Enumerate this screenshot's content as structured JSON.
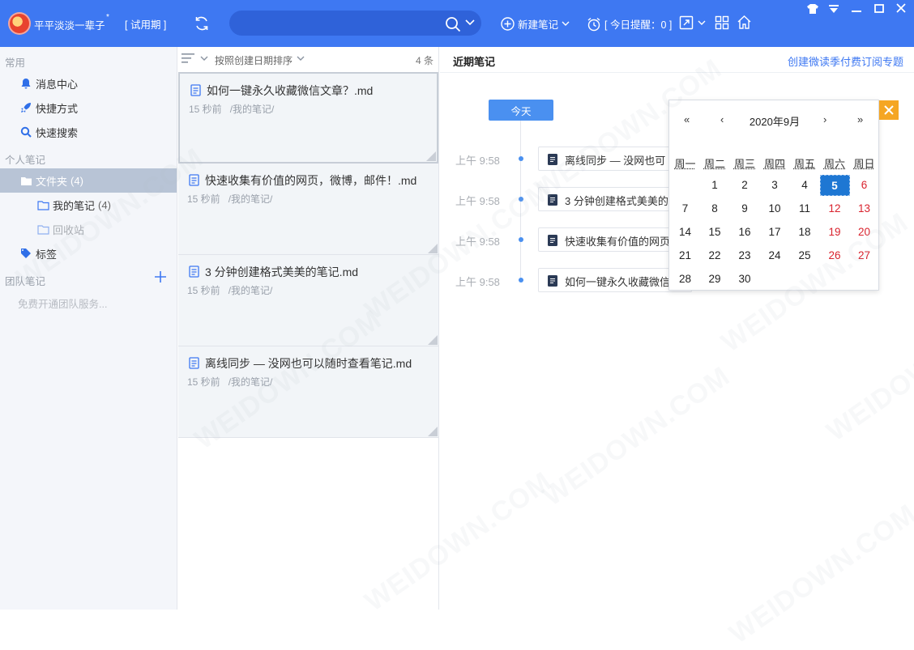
{
  "app": {
    "username": "平平淡淡一辈子",
    "username_mark": "*",
    "trial": "[ 试用期 ]",
    "new_note": "新建笔记",
    "reminder": "[ 今日提醒：0 ]",
    "search_placeholder": "",
    "accent": "#3e78f2"
  },
  "sidebar": {
    "section_common": "常用",
    "items": [
      {
        "label": "消息中心",
        "icon": "bell-icon"
      },
      {
        "label": "快捷方式",
        "icon": "rocket-icon"
      },
      {
        "label": "快速搜索",
        "icon": "search-icon"
      }
    ],
    "section_personal": "个人笔记",
    "folder": {
      "label": "文件夹",
      "count": "(4)"
    },
    "my_notes": {
      "label": "我的笔记",
      "count": "(4)"
    },
    "recycle": {
      "label": "回收站"
    },
    "tags": {
      "label": "标签"
    },
    "section_team": "团队笔记",
    "team_free": "免费开通团队服务..."
  },
  "notelist": {
    "sort_label": "按照创建日期排序",
    "count": "4 条",
    "notes": [
      {
        "title": "如何一键永久收藏微信文章？.md",
        "time": "15 秒前",
        "path": "/我的笔记/"
      },
      {
        "title": "快速收集有价值的网页，微博，邮件！.md",
        "time": "15 秒前",
        "path": "/我的笔记/"
      },
      {
        "title": "3 分钟创建格式美美的笔记.md",
        "time": "15 秒前",
        "path": "/我的笔记/"
      },
      {
        "title": "离线同步 — 没网也可以随时查看笔记.md",
        "time": "15 秒前",
        "path": "/我的笔记/"
      }
    ]
  },
  "recent": {
    "title": "近期笔记",
    "link": "创建微读季付费订阅专题",
    "today": "今天",
    "items": [
      {
        "time": "上午 9:58",
        "title": "离线同步 — 没网也可"
      },
      {
        "time": "上午 9:58",
        "title": "3 分钟创建格式美美的"
      },
      {
        "time": "上午 9:58",
        "title": "快速收集有价值的网页"
      },
      {
        "time": "上午 9:58",
        "title": "如何一键永久收藏微信"
      }
    ]
  },
  "calendar": {
    "prev_year": "«",
    "prev_month": "‹",
    "month_label": "2020年9月",
    "next_month": "›",
    "next_year": "»",
    "weekdays": [
      "周一",
      "周二",
      "周三",
      "周四",
      "周五",
      "周六",
      "周日"
    ],
    "first_weekday_index": 1,
    "days_in_month": 30,
    "selected_day": 5,
    "weekend_color": "#d9232e",
    "selected_color": "#1e77d3"
  },
  "watermark": "WEIDOWN.COM"
}
